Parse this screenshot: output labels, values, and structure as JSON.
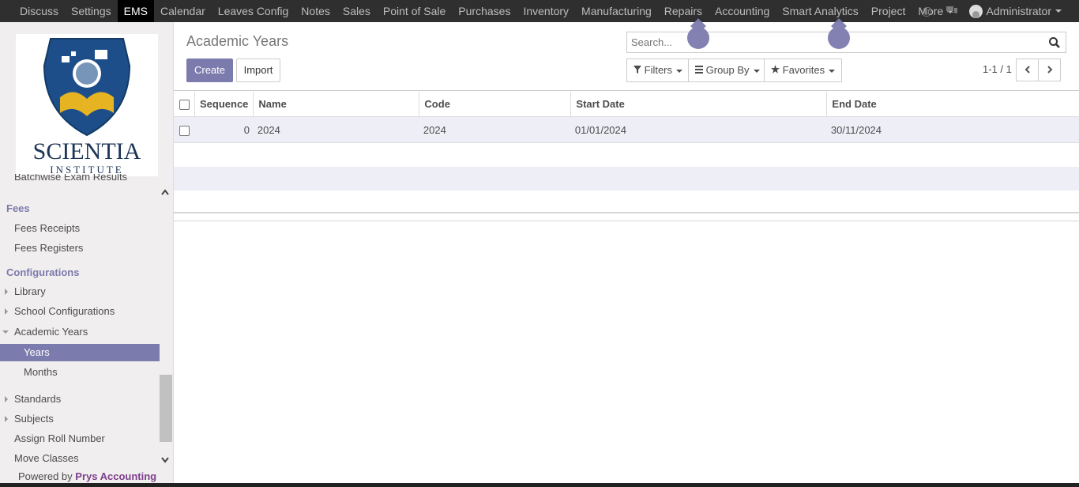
{
  "topbar": {
    "menu": [
      "Discuss",
      "Settings",
      "EMS",
      "Calendar",
      "Leaves Config",
      "Notes",
      "Sales",
      "Point of Sale",
      "Purchases",
      "Inventory",
      "Manufacturing",
      "Repairs",
      "Accounting",
      "Smart Analytics",
      "Project",
      "More"
    ],
    "active": "EMS",
    "user": "Administrator"
  },
  "logo": {
    "name": "SCIENTIA",
    "sub": "INSTITUTE"
  },
  "sidebar": {
    "partial_item": "Batchwise Exam Results",
    "fees_header": "Fees",
    "fees_receipts": "Fees Receipts",
    "fees_registers": "Fees Registers",
    "config_header": "Configurations",
    "library": "Library",
    "school_config": "School Configurations",
    "academic_years": "Academic Years",
    "years": "Years",
    "months": "Months",
    "standards": "Standards",
    "subjects": "Subjects",
    "assign_roll": "Assign Roll Number",
    "move_classes": "Move Classes",
    "powered_prefix": "Powered by",
    "powered_brand": "Prys Accounting"
  },
  "content": {
    "title": "Academic Years",
    "create_label": "Create",
    "import_label": "Import",
    "search_placeholder": "Search...",
    "filters_label": "Filters",
    "groupby_label": "Group By",
    "favorites_label": "Favorites",
    "pager": "1-1 / 1"
  },
  "table": {
    "headers": {
      "sequence": "Sequence",
      "name": "Name",
      "code": "Code",
      "start": "Start Date",
      "end": "End Date"
    },
    "rows": [
      {
        "sequence": "0",
        "name": "2024",
        "code": "2024",
        "start": "01/01/2024",
        "end": "30/11/2024"
      }
    ]
  },
  "colors": {
    "accent": "#7c7bad",
    "topbar": "#2f2f2f"
  }
}
